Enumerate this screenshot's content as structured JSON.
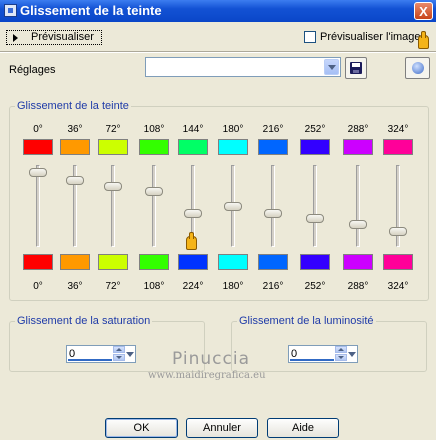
{
  "window": {
    "title": "Glissement de la teinte",
    "close_label": "X"
  },
  "toolbar": {
    "preview_button_label": "Prévisualiser",
    "preview_image_label": "Prévisualiser l'image",
    "preview_image_checked": false
  },
  "settings": {
    "label": "Réglages",
    "value": ""
  },
  "hue": {
    "title": "Glissement de la teinte",
    "top_labels": [
      "0°",
      "36°",
      "72°",
      "108°",
      "144°",
      "180°",
      "216°",
      "252°",
      "288°",
      "324°"
    ],
    "bottom_labels": [
      "0°",
      "36°",
      "72°",
      "108°",
      "224°",
      "180°",
      "216°",
      "252°",
      "288°",
      "324°"
    ],
    "top_colors": [
      "#ff0000",
      "#ff9900",
      "#ccff00",
      "#33ff00",
      "#00ff66",
      "#00ffff",
      "#0066ff",
      "#3300ff",
      "#cc00ff",
      "#ff0099"
    ],
    "bottom_colors": [
      "#ff0000",
      "#ff9900",
      "#ccff00",
      "#33ff00",
      "#0033ff",
      "#00ffff",
      "#0066ff",
      "#3300ff",
      "#cc00ff",
      "#ff0099"
    ],
    "slider_levels": [
      0.92,
      0.82,
      0.75,
      0.68,
      0.42,
      0.5,
      0.42,
      0.35,
      0.28,
      0.2
    ]
  },
  "saturation": {
    "title": "Glissement de la saturation",
    "value": "0"
  },
  "luminosity": {
    "title": "Glissement de la luminosité",
    "value": "0"
  },
  "watermark": {
    "name": "Pinuccia",
    "site": "www.maidiregrafica.eu"
  },
  "buttons": {
    "ok": "OK",
    "cancel": "Annuler",
    "help": "Aide"
  }
}
